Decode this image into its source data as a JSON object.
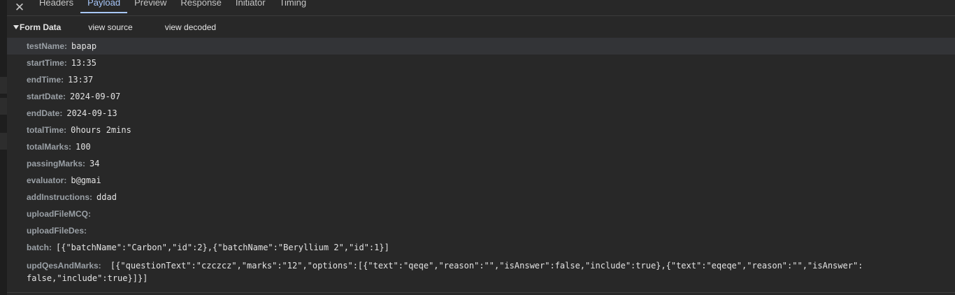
{
  "tabs": [
    {
      "label": "Headers"
    },
    {
      "label": "Payload"
    },
    {
      "label": "Preview"
    },
    {
      "label": "Response"
    },
    {
      "label": "Initiator"
    },
    {
      "label": "Timing"
    }
  ],
  "close_glyph": "✕",
  "section": {
    "title": "Form Data",
    "view_source": "view source",
    "view_decoded": "view decoded"
  },
  "fields": [
    {
      "key": "testName:",
      "value": "bapap"
    },
    {
      "key": "startTime:",
      "value": "13:35"
    },
    {
      "key": "endTime:",
      "value": "13:37"
    },
    {
      "key": "startDate:",
      "value": "2024-09-07"
    },
    {
      "key": "endDate:",
      "value": "2024-09-13"
    },
    {
      "key": "totalTime:",
      "value": "0hours 2mins"
    },
    {
      "key": "totalMarks:",
      "value": "100"
    },
    {
      "key": "passingMarks:",
      "value": "34"
    },
    {
      "key": "evaluator:",
      "value": "b@gmai"
    },
    {
      "key": "addInstructions:",
      "value": "ddad"
    },
    {
      "key": "uploadFileMCQ:",
      "value": ""
    },
    {
      "key": "uploadFileDes:",
      "value": ""
    },
    {
      "key": "batch:",
      "value": "[{\"batchName\":\"Carbon\",\"id\":2},{\"batchName\":\"Beryllium 2\",\"id\":1}]"
    },
    {
      "key": "updQesAndMarks:",
      "value": "[{\"questionText\":\"czczcz\",\"marks\":\"12\",\"options\":[{\"text\":\"qeqe\",\"reason\":\"\",\"isAnswer\":false,\"include\":true},{\"text\":\"eqeqe\",\"reason\":\"\",\"isAnswer\":false,\"include\":true}]}]"
    }
  ]
}
